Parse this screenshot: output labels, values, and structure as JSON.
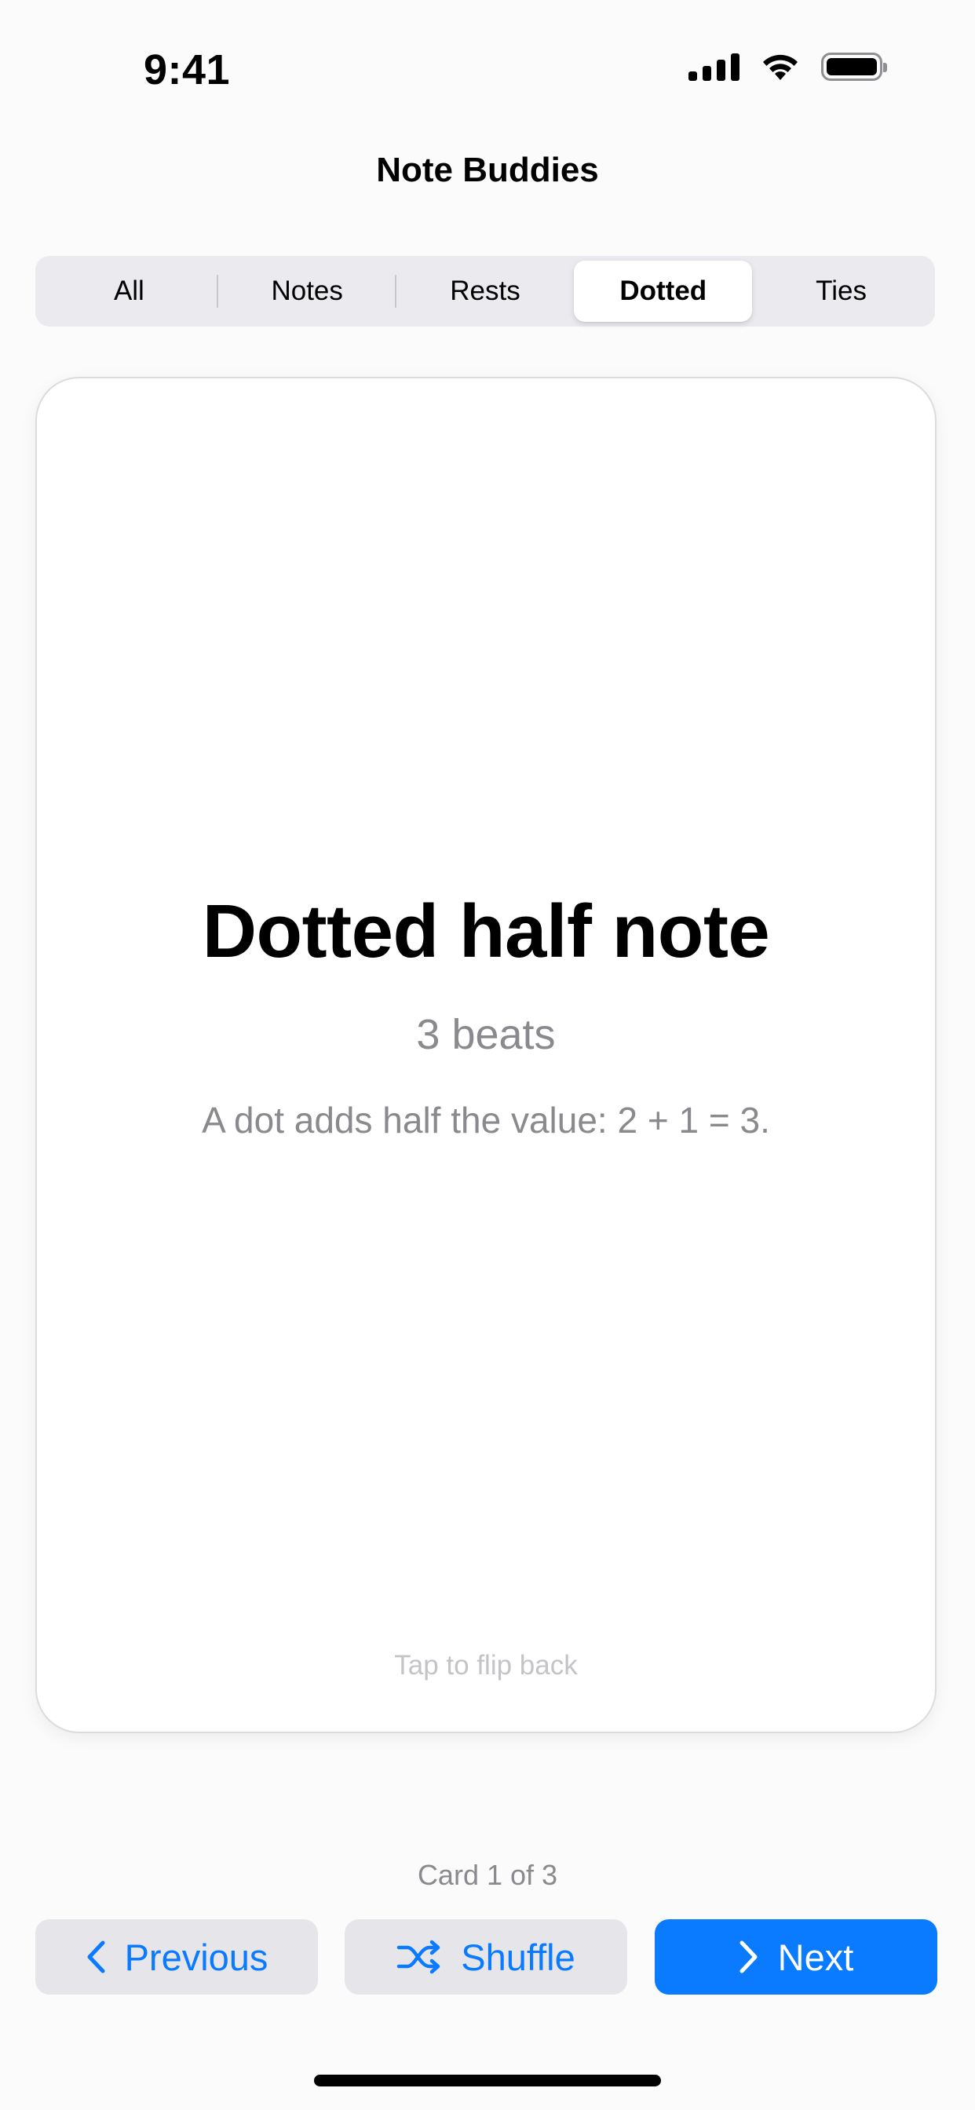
{
  "status_bar": {
    "time": "9:41",
    "icons": [
      "cellular-signal-icon",
      "wifi-icon",
      "battery-icon"
    ]
  },
  "nav": {
    "title": "Note Buddies"
  },
  "tabs": {
    "selected": "Dotted",
    "items": [
      {
        "label": "All"
      },
      {
        "label": "Notes"
      },
      {
        "label": "Rests"
      },
      {
        "label": "Dotted"
      },
      {
        "label": "Ties"
      }
    ]
  },
  "card": {
    "term": "Dotted half note",
    "value": "3 beats",
    "explanation": "A dot adds half the value: 2 + 1 = 3.",
    "hint": "Tap to flip back"
  },
  "counter": {
    "text": "Card 1 of 3"
  },
  "buttons": {
    "previous": {
      "label": "Previous",
      "icon": "chevron-left-icon"
    },
    "shuffle": {
      "label": "Shuffle",
      "icon": "shuffle-icon"
    },
    "next": {
      "label": "Next",
      "icon": "chevron-right-icon"
    }
  },
  "colors": {
    "accent": "#0A7AFF",
    "secondary_button_bg": "#E6E6EA",
    "segmented_bg": "#EBEBEF",
    "muted_text": "#8A8A8E"
  }
}
